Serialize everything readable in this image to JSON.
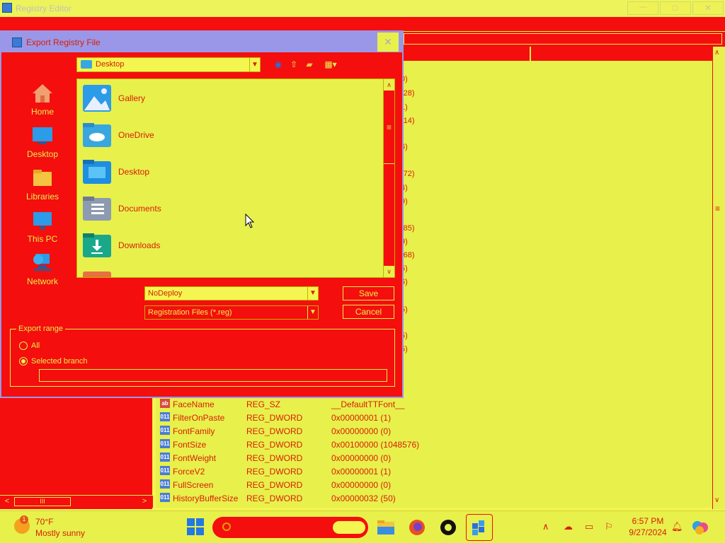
{
  "regedit": {
    "title": "Registry Editor",
    "min_glyph": "—",
    "max_glyph": "□",
    "close_glyph": "✕",
    "right_peek": [
      "0)",
      "(28)",
      "1)",
      "(14)",
      ")",
      "6)",
      "(72)",
      "4)",
      "9)",
      ")",
      "(85)",
      "9)",
      "(68)",
      "5)",
      "6)",
      "5)",
      "5)",
      "5)"
    ],
    "values": [
      {
        "icon": "ab",
        "name": "FaceName",
        "type": "REG_SZ",
        "data": "__DefaultTTFont__"
      },
      {
        "icon": "011",
        "name": "FilterOnPaste",
        "type": "REG_DWORD",
        "data": "0x00000001 (1)"
      },
      {
        "icon": "011",
        "name": "FontFamily",
        "type": "REG_DWORD",
        "data": "0x00000000 (0)"
      },
      {
        "icon": "011",
        "name": "FontSize",
        "type": "REG_DWORD",
        "data": "0x00100000 (1048576)"
      },
      {
        "icon": "011",
        "name": "FontWeight",
        "type": "REG_DWORD",
        "data": "0x00000000 (0)"
      },
      {
        "icon": "011",
        "name": "ForceV2",
        "type": "REG_DWORD",
        "data": "0x00000001 (1)"
      },
      {
        "icon": "011",
        "name": "FullScreen",
        "type": "REG_DWORD",
        "data": "0x00000000 (0)"
      },
      {
        "icon": "011",
        "name": "HistoryBufferSize",
        "type": "REG_DWORD",
        "data": "0x00000032 (50)"
      }
    ]
  },
  "dialog": {
    "title": "Export Registry File",
    "close_glyph": "✕",
    "places": [
      {
        "label": "Home",
        "icon": "home-icon"
      },
      {
        "label": "Desktop",
        "icon": "desktop-icon"
      },
      {
        "label": "Libraries",
        "icon": "libraries-icon"
      },
      {
        "label": "This PC",
        "icon": "this-pc-icon"
      },
      {
        "label": "Network",
        "icon": "network-icon"
      }
    ],
    "look_in": "Desktop",
    "files": [
      {
        "name": "Gallery",
        "icon": "gallery-icon"
      },
      {
        "name": "OneDrive",
        "icon": "onedrive-icon"
      },
      {
        "name": "Desktop",
        "icon": "desktop-folder-icon"
      },
      {
        "name": "Documents",
        "icon": "documents-folder-icon"
      },
      {
        "name": "Downloads",
        "icon": "downloads-folder-icon"
      }
    ],
    "filename": "NoDeploy",
    "filetype": "Registration Files (*.reg)",
    "save_label": "Save",
    "cancel_label": "Cancel",
    "export_range": {
      "legend": "Export range",
      "all_label": "All",
      "selected_label": "Selected branch",
      "selected": "Selected branch",
      "branch_value": ""
    }
  },
  "taskbar": {
    "temp": "70°F",
    "condition": "Mostly sunny",
    "weather_badge": "1",
    "time": "6:57 PM",
    "date": "9/27/2024"
  },
  "colors": {
    "accent_red": "#F40E0E",
    "accent_yellow": "#E8F04C",
    "text_red": "#D81E05",
    "titlebar_purple": "#9B97E8"
  }
}
